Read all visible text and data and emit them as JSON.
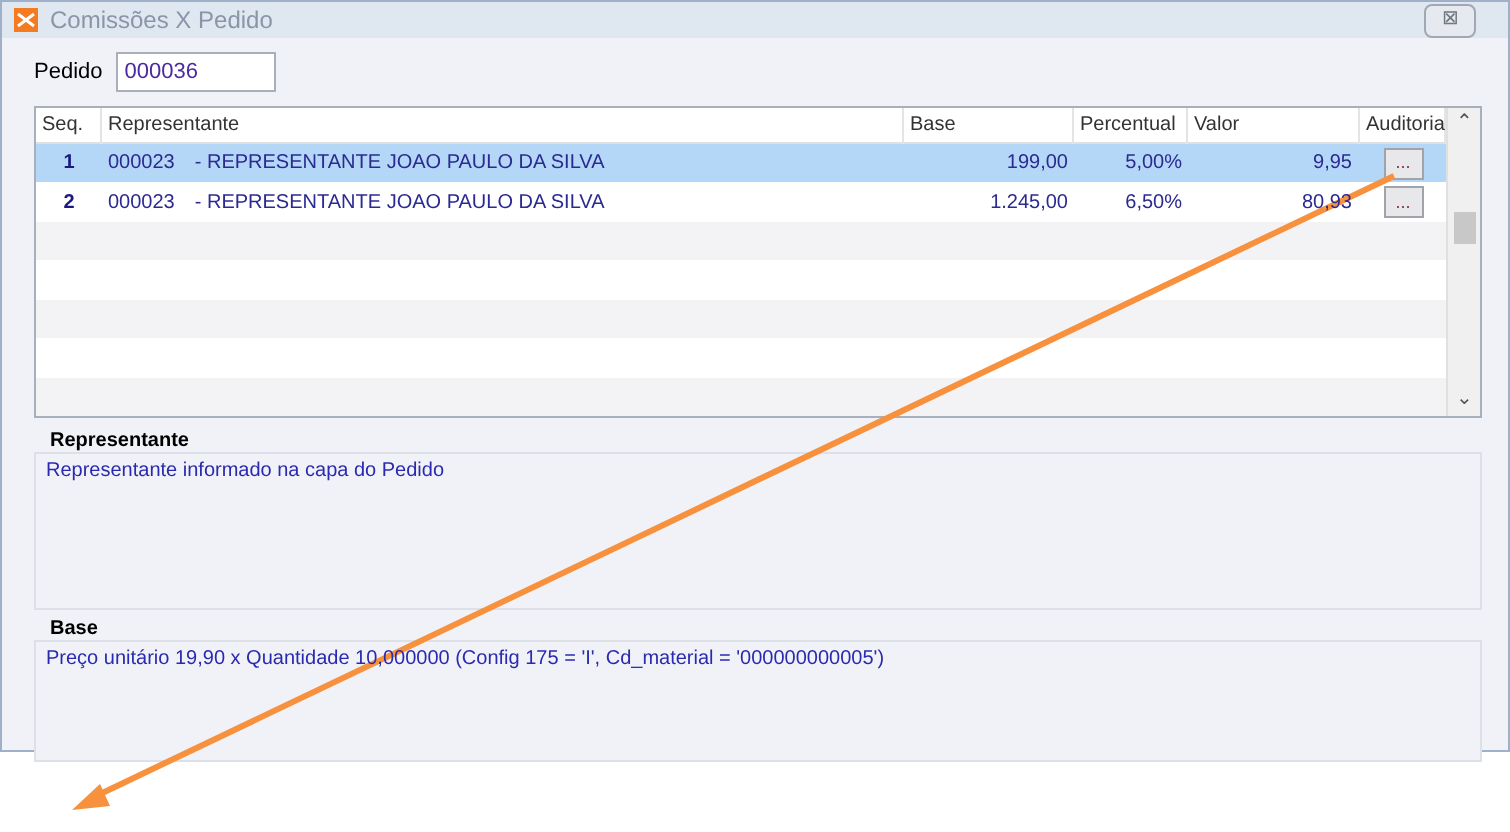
{
  "window": {
    "title": "Comissões X Pedido",
    "close": "⊠"
  },
  "pedido": {
    "label": "Pedido",
    "value": "000036"
  },
  "table": {
    "columns": [
      "Seq.",
      "Representante",
      "Base",
      "Percentual",
      "Valor",
      "Auditoria"
    ],
    "rows": [
      {
        "seq": "1",
        "code": "000023",
        "name": "- REPRESENTANTE JOAO PAULO DA SILVA",
        "base": "199,00",
        "percentual": "5,00%",
        "valor": "9,95",
        "auditoria": "...",
        "selected": true
      },
      {
        "seq": "2",
        "code": "000023",
        "name": "- REPRESENTANTE JOAO PAULO DA SILVA",
        "base": "1.245,00",
        "percentual": "6,50%",
        "valor": "80,93",
        "auditoria": "...",
        "selected": false
      }
    ],
    "scroll_up": "⌃",
    "scroll_down": "⌄"
  },
  "panels": [
    {
      "title": "Representante",
      "text": "Representante informado na capa do Pedido"
    },
    {
      "title": "Base",
      "text": "Preço unitário 19,90 x Quantidade 10,000000 (Config 175 = 'I', Cd_material = '000000000005')"
    }
  ]
}
